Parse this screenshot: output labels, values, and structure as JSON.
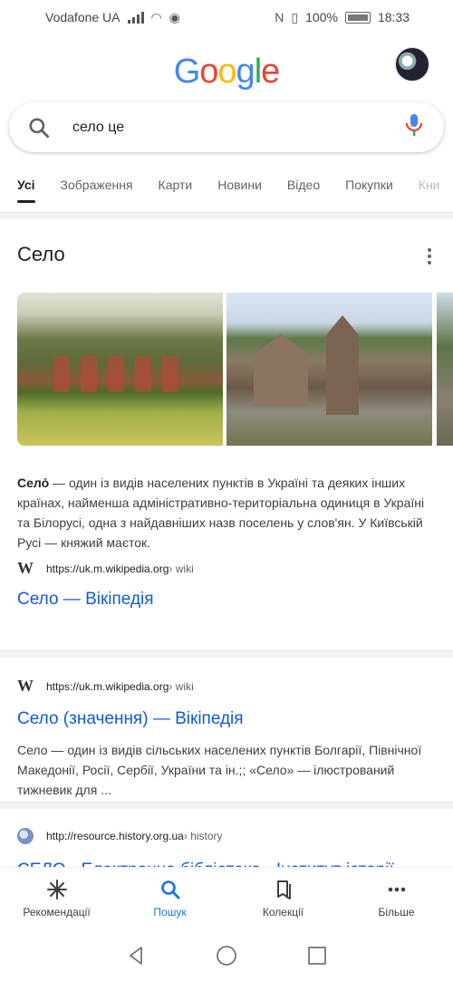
{
  "status_bar": {
    "carrier": "Vodafone UA",
    "battery": "100%",
    "time": "18:33",
    "icons": [
      "signal-icon",
      "wifi-icon",
      "eye-icon",
      "nfc-icon",
      "vibrate-icon",
      "battery-icon"
    ]
  },
  "header": {
    "logo": "Google",
    "logo_colors": [
      "#4285F4",
      "#EA4335",
      "#FBBC05",
      "#4285F4",
      "#34A853",
      "#EA4335"
    ]
  },
  "search": {
    "query": "село це"
  },
  "tabs": [
    {
      "label": "Усі",
      "active": true
    },
    {
      "label": "Зображення"
    },
    {
      "label": "Карти"
    },
    {
      "label": "Новини"
    },
    {
      "label": "Відео"
    },
    {
      "label": "Покупки"
    },
    {
      "label": "Кни"
    }
  ],
  "knowledge_panel": {
    "title": "Село",
    "description_bold": "Село́",
    "description_rest": " — один із видів населених пунктів в Україні та деяких інших країнах, найменша адміністративно-територіальна одиниця в Україні та Білорусі, одна з найдавніших назв поселень у слов'ян. У Київській Русі — княжий маєток.",
    "source_url": "https://uk.m.wikipedia.org",
    "source_crumb": " › wiki",
    "link_title": "Село — Вікіпедія"
  },
  "results": [
    {
      "url": "https://uk.m.wikipedia.org",
      "crumb": " › wiki",
      "title": "Село (значення) — Вікіпедія",
      "snippet": "Село — один із видів сільських населених пунктів Болгарії, Північної Македонії, Росії, Сербії, України та ін.;; «Село» — ілюстрований тижневик для ..."
    },
    {
      "url": "http://resource.history.org.ua",
      "crumb": " › history",
      "title": "СЕЛО - Електронна бібліотека - Інститут історії"
    }
  ],
  "bottom_nav": [
    {
      "label": "Рекомендації",
      "icon": "asterisk-icon"
    },
    {
      "label": "Пошук",
      "icon": "search-icon",
      "active": true
    },
    {
      "label": "Колекції",
      "icon": "collections-icon"
    },
    {
      "label": "Більше",
      "icon": "more-icon"
    }
  ],
  "colors": {
    "link": "#1558d6",
    "active_nav": "#1a73e8"
  }
}
